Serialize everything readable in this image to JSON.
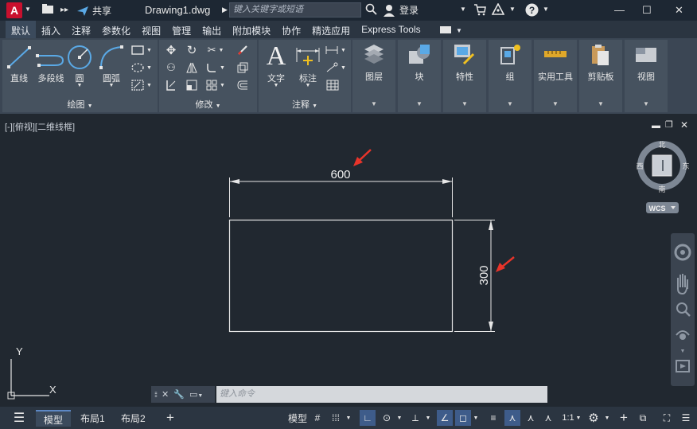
{
  "titlebar": {
    "logo": "A",
    "share": "共享",
    "filename": "Drawing1.dwg",
    "search_placeholder": "键入关键字或短语",
    "login": "登录"
  },
  "tabs": [
    "默认",
    "插入",
    "注释",
    "参数化",
    "视图",
    "管理",
    "输出",
    "附加模块",
    "协作",
    "精选应用",
    "Express Tools"
  ],
  "ribbon": {
    "draw": {
      "line": "直线",
      "polyline": "多段线",
      "circle": "圆",
      "arc": "圆弧",
      "group_label": "绘图"
    },
    "modify": {
      "group_label": "修改"
    },
    "annotation": {
      "text": "文字",
      "dimension": "标注",
      "group_label": "注释"
    },
    "panels": [
      "图层",
      "块",
      "特性",
      "组",
      "实用工具",
      "剪贴板",
      "视图"
    ]
  },
  "viewport": {
    "label": "[-][俯视][二维线框]",
    "dim_width": "600",
    "dim_height": "300",
    "viewcube": {
      "north": "北",
      "south": "南",
      "east": "东",
      "west": "西",
      "wcs": "WCS"
    },
    "ucs": {
      "x": "X",
      "y": "Y"
    }
  },
  "commandline": {
    "placeholder": "键入命令"
  },
  "status": {
    "layout_tabs": [
      "模型",
      "布局1",
      "布局2"
    ],
    "model_btn": "模型",
    "scale": "1:1"
  },
  "colors": {
    "accent": "#3e5c8a",
    "arrow": "#e8342a",
    "background": "#212830"
  }
}
